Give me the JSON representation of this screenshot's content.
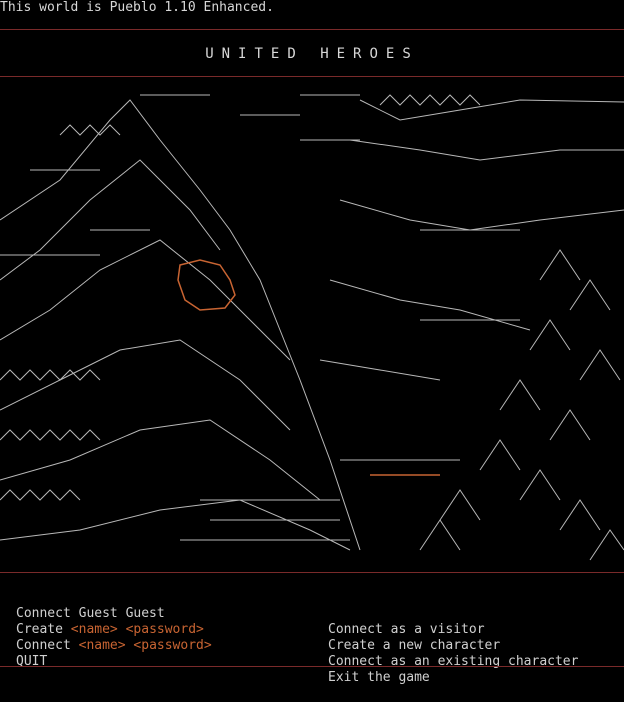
{
  "status_text": "This world is Pueblo 1.10 Enhanced.",
  "banner_title": "UNITED HEROES",
  "menu": [
    {
      "cmd_plain": "Connect Guest Guest",
      "desc": "Connect as a visitor"
    },
    {
      "cmd_prefix": "Create ",
      "ph1": "<name>",
      "ph2": "<password>",
      "desc": "Create a new character"
    },
    {
      "cmd_prefix": "Connect ",
      "ph1": "<name>",
      "ph2": "<password>",
      "desc": "Connect as an existing character"
    },
    {
      "cmd_plain": "QUIT",
      "desc": "Exit the game"
    }
  ],
  "colors": {
    "divider": "#7a2a2a",
    "placeholder": "#c86432",
    "text": "#c8c8c8",
    "background": "#000000"
  }
}
